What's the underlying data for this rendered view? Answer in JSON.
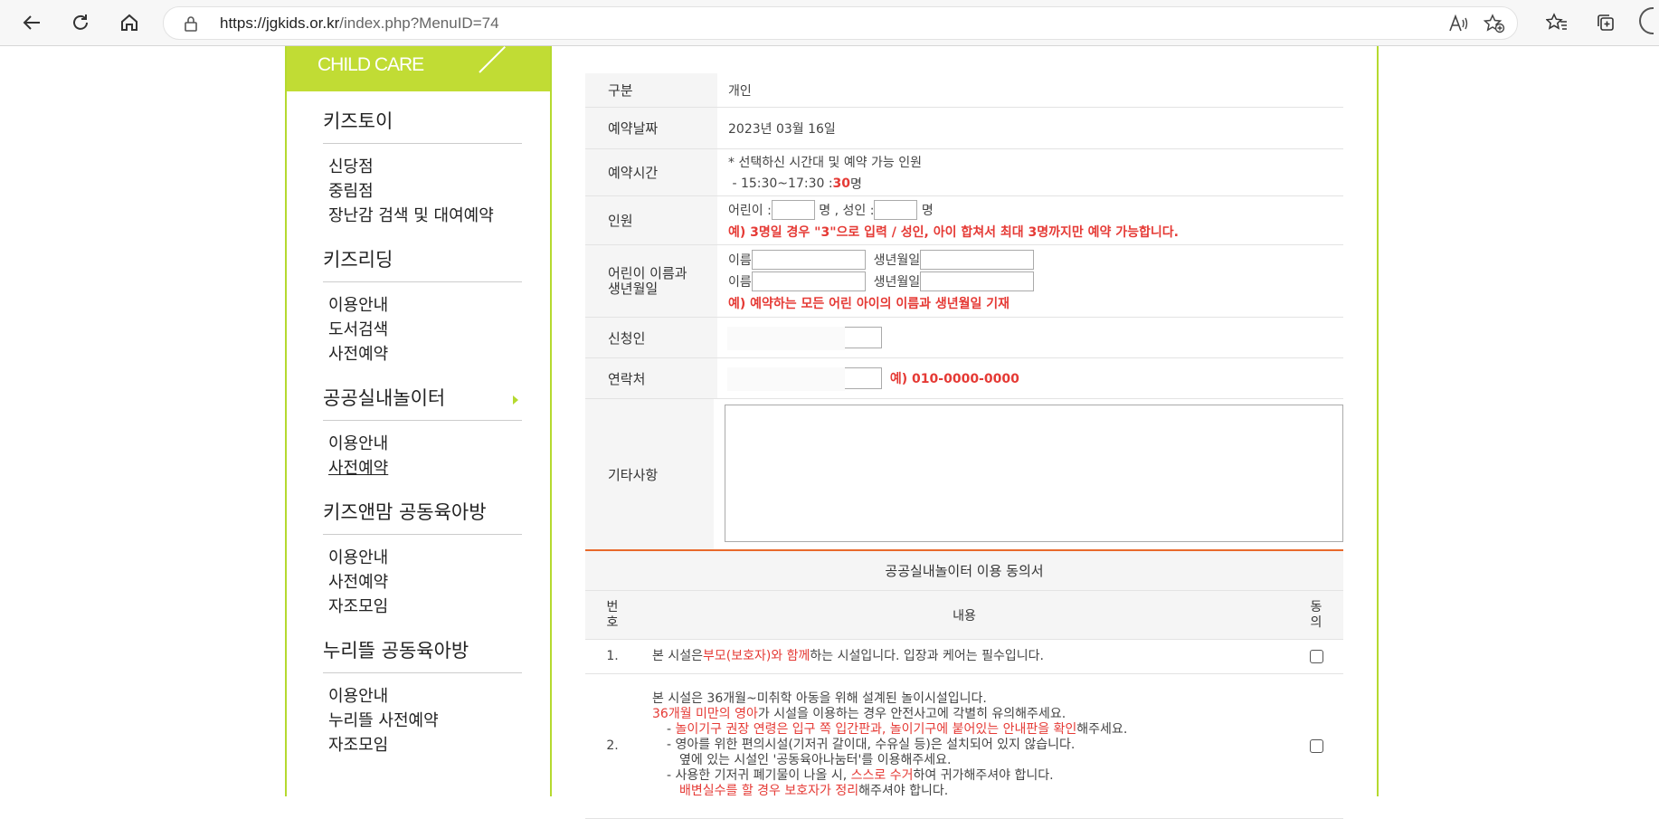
{
  "browser": {
    "url_host": "https://jgkids.or.kr",
    "url_path": "/index.php?MenuID=74"
  },
  "sidebar": {
    "logo_text": "CHILD CARE",
    "groups": [
      {
        "title": "키즈토이",
        "items": [
          "신당점",
          "중림점",
          "장난감 검색 및 대여예약"
        ]
      },
      {
        "title": "키즈리딩",
        "items": [
          "이용안내",
          "도서검색",
          "사전예약"
        ]
      },
      {
        "title": "공공실내놀이터",
        "items": [
          "이용안내",
          "사전예약"
        ]
      },
      {
        "title": "키즈앤맘 공동육아방",
        "items": [
          "이용안내",
          "사전예약",
          "자조모임"
        ]
      },
      {
        "title": "누리뜰 공동육아방",
        "items": [
          "이용안내",
          "누리뜰 사전예약",
          "자조모임"
        ]
      }
    ]
  },
  "form": {
    "type_label": "구분",
    "type_value": "개인",
    "date_label": "예약날짜",
    "date_value": "2023년 03월 16일",
    "time_label": "예약시간",
    "time_note": "* 선택하신 시간대 및 예약 가능 인원",
    "time_slot": "- 15:30~17:30 : ",
    "time_count": "30",
    "time_unit": "명",
    "people_label": "인원",
    "child_label": "어린이 :",
    "person_unit": "명",
    "adult_label": ", 성인 :",
    "person_unit2": "명",
    "people_note": "예) 3명일 경우 \"3\"으로 입력 / 성인, 아이 합쳐서 최대 3명까지만 예약 가능합니다.",
    "child_info_label_1": "어린이 이름과",
    "child_info_label_2": "생년월일",
    "name_label": "이름",
    "birth_label": "생년월일",
    "name_label2": "이름",
    "birth_label2": "생년월일",
    "child_info_note": "예) 예약하는 모든 어린 아이의 이름과 생년월일 기재",
    "applicant_label": "신청인",
    "contact_label": "연락처",
    "contact_example": "예) 010-0000-0000",
    "etc_label": "기타사항"
  },
  "agreement": {
    "title": "공공실내놀이터 이용 동의서",
    "col_no_1": "번",
    "col_no_2": "호",
    "col_content": "내용",
    "col_agree_1": "동",
    "col_agree_2": "의",
    "rows": [
      {
        "no": "1.",
        "p1": "본 시설은 ",
        "p1_red": "부모(보호자)와 함께",
        "p1_end": " 하는 시설입니다. 입장과 케어는 필수입니다."
      },
      {
        "no": "2.",
        "l1": "본 시설은 36개월~미취학 아동을 위해 설계된 놀이시설입니다.",
        "l2_red": "36개월 미만의 영아",
        "l2_end": "가 시설을 이용하는 경우 안전사고에 각별히 유의해주세요.",
        "l3_pre": "- ",
        "l3_red": "놀이기구 권장 연령은 입구 쪽 입간판과, 놀이기구에 붙어있는 안내판을 확인",
        "l3_end": "해주세요.",
        "l4": "- 영아를 위한 편의시설(기저귀 갈이대, 수유실 등)은 설치되어 있지 않습니다.",
        "l5": "옆에 있는 시설인 '공동육아나눔터'를 이용해주세요.",
        "l6_pre": "- 사용한 기저귀 폐기물이 나올 시, ",
        "l6_red": "스스로 수거",
        "l6_end": "하여 귀가해주셔야 합니다.",
        "l7_red": "배변실수를 할 경우 보호자가 정리",
        "l7_end": "해주셔야 합니다."
      }
    ]
  }
}
